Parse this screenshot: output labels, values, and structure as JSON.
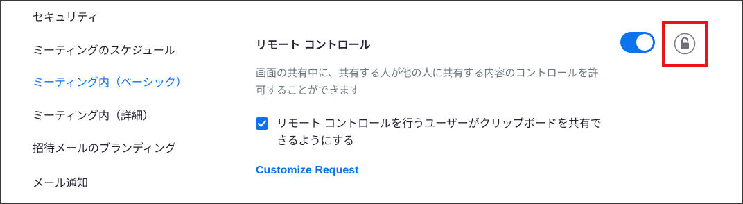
{
  "sidebar": {
    "items": [
      {
        "label": "セキュリティ",
        "active": false
      },
      {
        "label": "ミーティングのスケジュール",
        "active": false
      },
      {
        "label": "ミーティング内（ベーシック）",
        "active": true
      },
      {
        "label": "ミーティング内（詳細）",
        "active": false
      },
      {
        "label": "招待メールのブランディング",
        "active": false
      },
      {
        "label": "メール通知",
        "active": false
      }
    ]
  },
  "setting": {
    "title": "リモート コントロール",
    "description": "画面の共有中に、共有する人が他の人に共有する内容のコントロールを許可することができます",
    "toggle_on": true,
    "lock_icon": "unlock-icon",
    "checkbox_checked": true,
    "checkbox_label": "リモート コントロールを行うユーザーがクリップボードを共有できるようにする",
    "link_label": "Customize Request"
  },
  "colors": {
    "accent": "#0e72ed",
    "highlight": "#e8141c",
    "text": "#232333",
    "muted": "#6e7680"
  }
}
